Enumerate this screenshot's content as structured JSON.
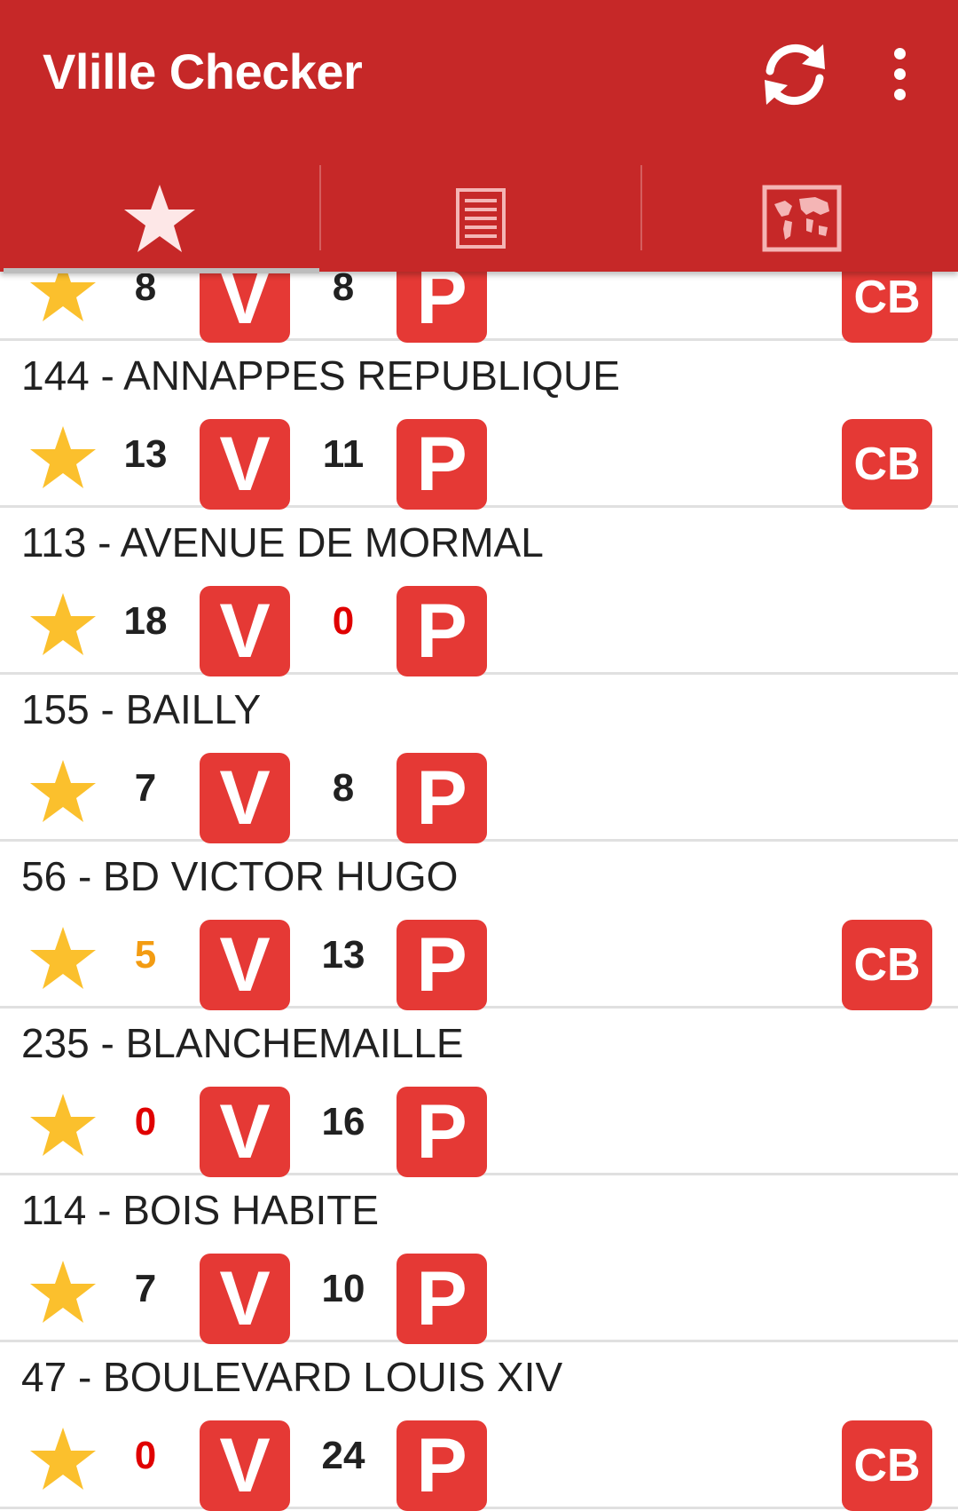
{
  "app": {
    "title": "Vlille Checker"
  },
  "tabs": [
    {
      "icon": "star-icon"
    },
    {
      "icon": "list-icon"
    },
    {
      "icon": "map-icon"
    }
  ],
  "colors": {
    "appbar": "#C62828",
    "tile": "#E53935",
    "star": "#FBC02D",
    "zero": "#E00000",
    "low": "#F39C12"
  },
  "labels": {
    "bikes_tile": "V",
    "stands_tile": "P",
    "card_tile": "CB"
  },
  "stations": [
    {
      "name": "",
      "bikes": "8",
      "stands": "8",
      "cb": true,
      "bikes_status": "normal",
      "stands_status": "normal"
    },
    {
      "name": "144 - ANNAPPES REPUBLIQUE",
      "bikes": "13",
      "stands": "11",
      "cb": true,
      "bikes_status": "normal",
      "stands_status": "normal"
    },
    {
      "name": "113 - AVENUE DE MORMAL",
      "bikes": "18",
      "stands": "0",
      "cb": false,
      "bikes_status": "normal",
      "stands_status": "zero"
    },
    {
      "name": "155 - BAILLY",
      "bikes": "7",
      "stands": "8",
      "cb": false,
      "bikes_status": "normal",
      "stands_status": "normal"
    },
    {
      "name": "56 - BD VICTOR HUGO",
      "bikes": "5",
      "stands": "13",
      "cb": true,
      "bikes_status": "low",
      "stands_status": "normal"
    },
    {
      "name": "235 - BLANCHEMAILLE",
      "bikes": "0",
      "stands": "16",
      "cb": false,
      "bikes_status": "zero",
      "stands_status": "normal"
    },
    {
      "name": "114 - BOIS HABITE",
      "bikes": "7",
      "stands": "10",
      "cb": false,
      "bikes_status": "normal",
      "stands_status": "normal"
    },
    {
      "name": "47 - BOULEVARD LOUIS XIV",
      "bikes": "0",
      "stands": "24",
      "cb": true,
      "bikes_status": "zero",
      "stands_status": "normal"
    }
  ]
}
